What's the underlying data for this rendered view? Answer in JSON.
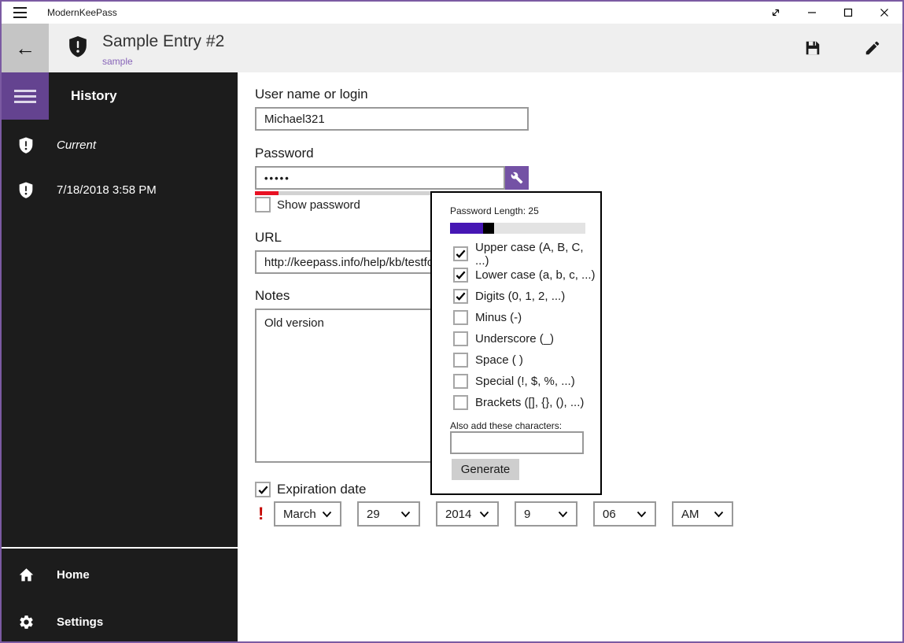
{
  "titlebar": {
    "app_title": "ModernKeePass"
  },
  "header": {
    "title": "Sample Entry #2",
    "subtitle": "sample"
  },
  "sidebar": {
    "heading": "History",
    "items": [
      {
        "label": "Current"
      },
      {
        "label": "7/18/2018 3:58 PM"
      }
    ],
    "footer": [
      {
        "label": "Home"
      },
      {
        "label": "Settings"
      }
    ]
  },
  "form": {
    "username": {
      "label": "User name or login",
      "value": "Michael321"
    },
    "password": {
      "label": "Password",
      "value": "•••••",
      "show_password_label": "Show password",
      "show_checked": false
    },
    "url": {
      "label": "URL",
      "value": "http://keepass.info/help/kb/testfo"
    },
    "notes": {
      "label": "Notes",
      "value": "Old version"
    },
    "expiration": {
      "label": "Expiration date",
      "checked": true,
      "warning": "!",
      "month": "March",
      "day": "29",
      "year": "2014",
      "hour": "9",
      "minute": "06",
      "ampm": "AM"
    }
  },
  "generator": {
    "length_label": "Password Length: 25",
    "length": 25,
    "slider_fill_percent": 25,
    "options": [
      {
        "label": "Upper case (A, B, C, ...)",
        "checked": true
      },
      {
        "label": "Lower case (a, b, c, ...)",
        "checked": true
      },
      {
        "label": "Digits (0, 1, 2, ...)",
        "checked": true
      },
      {
        "label": "Minus (-)",
        "checked": false
      },
      {
        "label": "Underscore (_)",
        "checked": false
      },
      {
        "label": "Space ( )",
        "checked": false
      },
      {
        "label": "Special (!, $, %, ...)",
        "checked": false
      },
      {
        "label": "Brackets ([], {}, (), ...)",
        "checked": false
      }
    ],
    "also_add_label": "Also add these characters:",
    "also_add_value": "",
    "generate_label": "Generate"
  },
  "icons": {
    "back": "←"
  },
  "colors": {
    "window_border": "#7b5aa2",
    "nav_accent": "#644390",
    "wrench_button": "#7452a5",
    "slider_fill": "#4617b4",
    "strength_red": "#e81123",
    "subtitle_link": "#8764b8",
    "sidebar_bg": "#1c1c1c",
    "header_bg": "#efefef",
    "back_button_bg": "#c5c5c5"
  }
}
